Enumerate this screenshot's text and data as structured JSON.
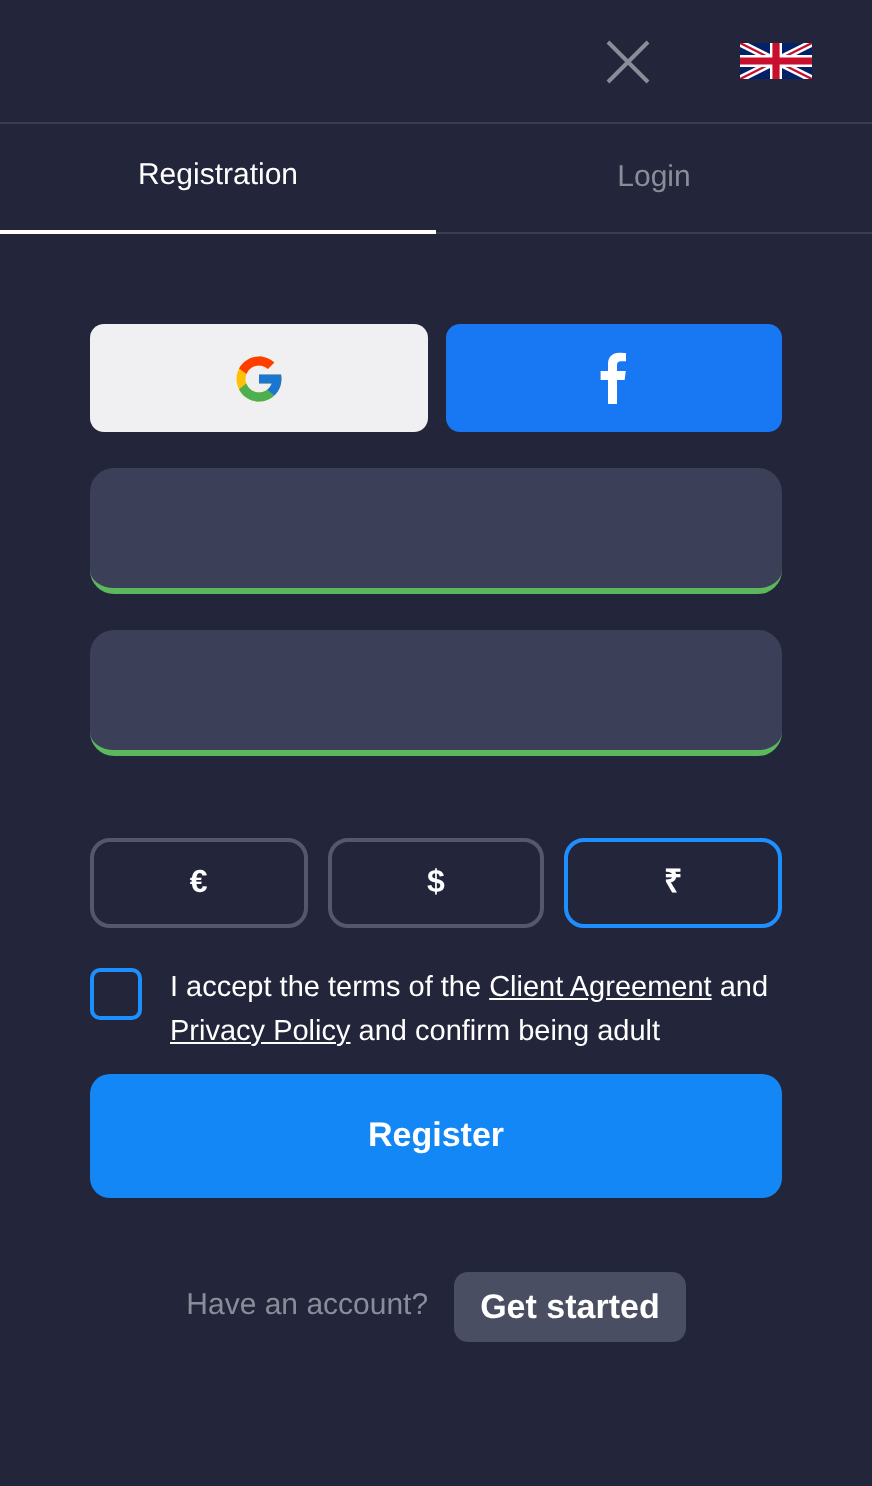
{
  "tabs": [
    {
      "label": "Registration",
      "selected": true
    },
    {
      "label": "Login",
      "selected": false
    }
  ],
  "social_buttons": [
    {
      "kind": "google"
    },
    {
      "kind": "facebook"
    }
  ],
  "fields": [
    {
      "valid": true
    },
    {
      "valid": true
    }
  ],
  "currencies": [
    {
      "symbol": "€",
      "selected": false
    },
    {
      "symbol": "$",
      "selected": false
    },
    {
      "symbol": "₹",
      "selected": true
    }
  ],
  "agreement": {
    "checked": false,
    "parts": [
      {
        "text": "I accept the terms of the ",
        "link": false
      },
      {
        "text": "Client Agreement",
        "link": true
      },
      {
        "text": " and ",
        "link": false
      },
      {
        "text": "Privacy Policy",
        "link": true
      },
      {
        "text": " and confirm being adult",
        "link": false
      }
    ]
  },
  "register_button": "Register",
  "footer": {
    "prompt": "Have an account?",
    "button": "Get started"
  }
}
